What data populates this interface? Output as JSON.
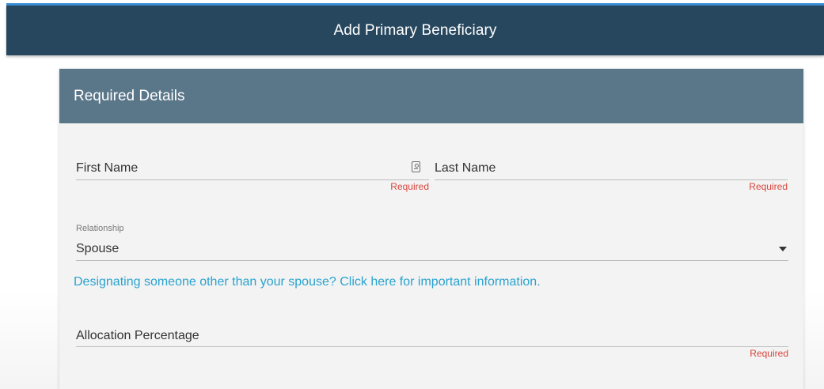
{
  "header": {
    "title": "Add Primary Beneficiary"
  },
  "card": {
    "title": "Required Details"
  },
  "form": {
    "first_name": {
      "label": "First Name",
      "error": "Required"
    },
    "last_name": {
      "label": "Last Name",
      "error": "Required"
    },
    "relationship": {
      "label": "Relationship",
      "value": "Spouse"
    },
    "info_link": "Designating someone other than your spouse? Click here for important information.",
    "allocation": {
      "label": "Allocation Percentage",
      "error": "Required"
    }
  },
  "icons": {
    "first_name_addon": "contact-card-icon",
    "relationship_dropdown": "caret-down-icon"
  },
  "colors": {
    "header_bg": "#27475e",
    "accent_bar": "#3a8fd8",
    "card_header_bg": "#5a7689",
    "error": "#d9443c",
    "link": "#2aa3cf"
  }
}
